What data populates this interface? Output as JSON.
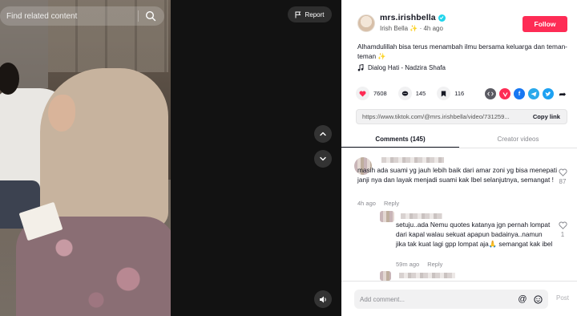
{
  "video": {
    "search_placeholder": "Find related content",
    "report_label": "Report"
  },
  "author": {
    "username": "mrs.irishbella",
    "display_name": "Irish Bella",
    "display_name_emoji": "✨",
    "time_ago": "4h ago",
    "follow_label": "Follow"
  },
  "post": {
    "caption": "Alhamdulillah bisa terus menambah ilmu bersama keluarga dan teman-teman ✨",
    "music": "Dialog Hati - Nadzira Shafa",
    "likes": "7608",
    "comments": "145",
    "saves": "116",
    "link": "https://www.tiktok.com/@mrs.irishbella/video/731259...",
    "copy_label": "Copy link"
  },
  "tabs": {
    "comments": "Comments (145)",
    "creator_videos": "Creator videos"
  },
  "comments": [
    {
      "text": "masih ada suami yg jauh lebih baik dari amar zoni yg bisa menepati janji nya dan layak menjadi suami kak Ibel selanjutnya, semangat !",
      "time": "4h ago",
      "reply": "Reply",
      "likes": "87"
    },
    {
      "text": "setuju..ada Nemu quotes katanya jgn pernah lompat dari kapal walau sekuat apapun badainya..namun jika tak kuat lagi gpp lompat aja🙏 semangat kak ibel",
      "time": "59m ago",
      "reply": "Reply",
      "likes": "1"
    }
  ],
  "comment_bar": {
    "placeholder": "Add comment...",
    "post_label": "Post"
  },
  "colors": {
    "accent": "#fe2c55",
    "verified": "#20d5ec"
  },
  "share_icons": [
    "embed-icon",
    "friends-icon",
    "facebook-icon",
    "telegram-icon",
    "twitter-icon",
    "share-arrow-icon"
  ]
}
